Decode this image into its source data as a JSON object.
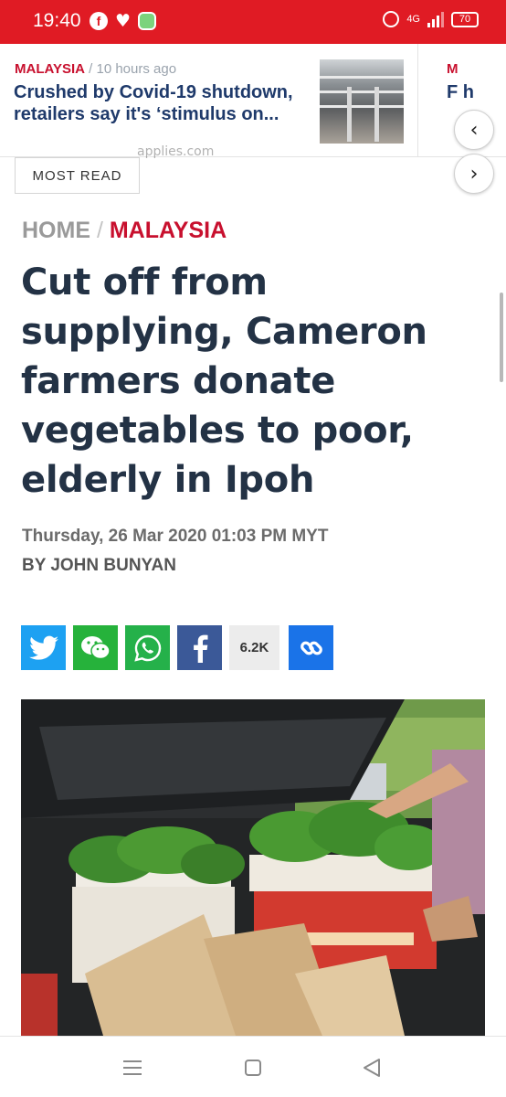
{
  "status_bar": {
    "time": "19:40",
    "network": "4G",
    "battery": "70"
  },
  "trending": {
    "card": {
      "category": "MALAYSIA",
      "separator": "/",
      "time_ago": "10 hours ago",
      "title": "Crushed by Covid-19 shutdown, retailers say it's ‘stimulus on...",
      "thumbnail_icon": "mall-photo"
    },
    "next_card": {
      "category": "M",
      "title": "F h"
    },
    "prev_icon": "chevron-left-icon",
    "next_icon": "chevron-right-icon"
  },
  "most_read": {
    "label": "MOST READ",
    "ticker_text": "applies.com"
  },
  "article": {
    "breadcrumb": {
      "home": "HOME",
      "separator": "/",
      "category": "MALAYSIA"
    },
    "headline": "Cut off from supplying, Cameron farmers donate vegetables to poor, elderly in Ipoh",
    "date": "Thursday, 26 Mar 2020 01:03 PM MYT",
    "byline": "BY JOHN BUNYAN",
    "share": {
      "count": "6.2K",
      "icons": [
        "twitter-icon",
        "wechat-icon",
        "whatsapp-icon",
        "facebook-icon",
        "link-icon"
      ]
    },
    "photo_icon": "vegetable-boxes-photo"
  },
  "colors": {
    "status_bar": "#e01b24",
    "accent_red": "#c8102e",
    "headline": "#233245",
    "twitter": "#1da1f2",
    "wechat": "#26b23b",
    "whatsapp": "#25b14a",
    "facebook": "#3b5998",
    "link": "#1a73e8"
  },
  "system_nav": {
    "icons": [
      "menu-icon",
      "home-icon",
      "back-icon"
    ]
  }
}
